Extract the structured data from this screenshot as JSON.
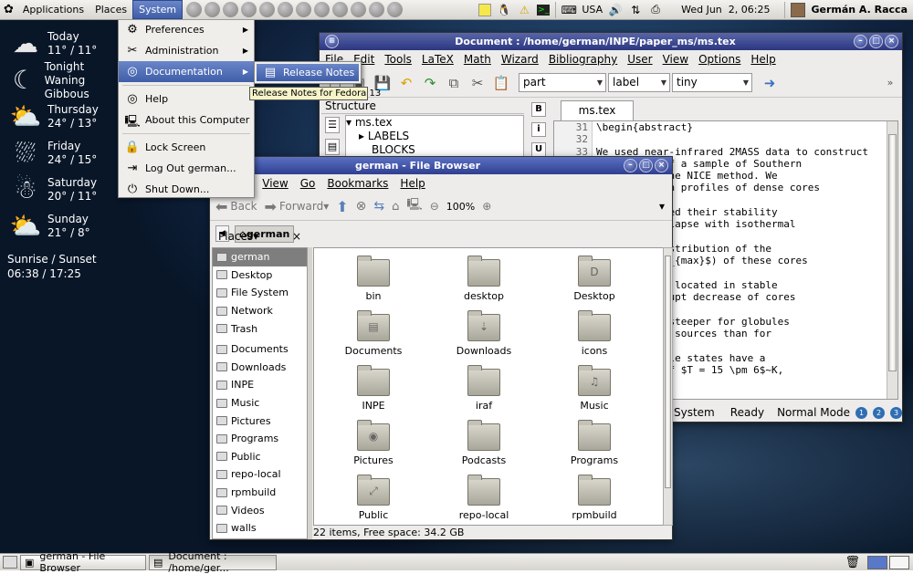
{
  "top_panel": {
    "menus": [
      "Applications",
      "Places",
      "System"
    ],
    "launchers": [
      "help-icon",
      "mail-icon",
      "chat-icon",
      "irc-icon",
      "im-icon",
      "network-icon",
      "music-icon",
      "star-icon",
      "web-icon",
      "doc-icon",
      "tools-icon",
      "terminal-icon"
    ],
    "keyboard_layout": "USA",
    "clock": "Wed Jun  2, 06:25",
    "user": "Germán A. Racca"
  },
  "weather": {
    "days": [
      {
        "name": "Today",
        "temps": "11° / 11°",
        "icon": "cloud-icon"
      },
      {
        "name": "Tonight",
        "temps": "Waning Gibbous",
        "icon": "moon-icon"
      },
      {
        "name": "Thursday",
        "temps": "24° / 13°",
        "icon": "sun-cloud-icon"
      },
      {
        "name": "Friday",
        "temps": "24° / 15°",
        "icon": "rain-icon"
      },
      {
        "name": "Saturday",
        "temps": "20° / 11°",
        "icon": "snow-cloud-icon"
      },
      {
        "name": "Sunday",
        "temps": "21° / 8°",
        "icon": "sun-cloud-icon"
      }
    ],
    "sun_label": "Sunrise / Sunset",
    "sun_times": "06:38 / 17:25"
  },
  "system_menu": {
    "items": [
      {
        "label": "Preferences",
        "submenu": true,
        "icon": "preferences-icon"
      },
      {
        "label": "Administration",
        "submenu": true,
        "icon": "administration-icon"
      },
      {
        "label": "Documentation",
        "submenu": true,
        "icon": "lifebuoy-icon"
      },
      {
        "label": "Help",
        "submenu": false,
        "icon": "help-icon"
      },
      {
        "label": "About this Computer",
        "submenu": false,
        "icon": "computer-icon"
      },
      {
        "label": "Lock Screen",
        "submenu": false,
        "icon": "lock-icon"
      },
      {
        "label": "Log Out german...",
        "submenu": false,
        "icon": "logout-icon"
      },
      {
        "label": "Shut Down...",
        "submenu": false,
        "icon": "shutdown-icon"
      }
    ],
    "submenu_item": "Release Notes",
    "tooltip": "Release Notes for Fedora 13"
  },
  "kile": {
    "title": "Document : /home/german/INPE/paper_ms/ms.tex",
    "menu": [
      "File",
      "Edit",
      "Tools",
      "LaTeX",
      "Math",
      "Wizard",
      "Bibliography",
      "User",
      "View",
      "Options",
      "Help"
    ],
    "combos": [
      "part",
      "label",
      "tiny"
    ],
    "structure_title": "Structure",
    "tree": [
      "ms.tex",
      "LABELS",
      "BLOCKS"
    ],
    "tab": "ms.tex",
    "line_numbers": [
      "31",
      "32",
      "33"
    ],
    "code_lines": [
      "\\begin{abstract}",
      "",
      "We used near-infrared 2MASS data to construct",
      "  ion maps of a sample of Southern",
      "  tilizing the NICE method. We",
      "   extinction profiles of dense cores",
      "",
      "s and analyzed their stability",
      "rational collapse with isothermal",
      "",
      "frequency distribution of the",
      "ameter ($\\xi_{max}$) of these cores",
      "",
      " of them are located in stable",
      "ed by an abrupt decrease of cores",
      "",
      "decrease is steeper for globules",
      "d IRAS point sources than for",
      "les.",
      "ules in stable states have a",
      "emperature of $T = 15 \\pm 6$~K,"
    ],
    "status": {
      "section": "System",
      "state": "Ready",
      "mode": "Normal Mode",
      "dots": [
        "1",
        "2",
        "3"
      ]
    }
  },
  "file_browser": {
    "title": "german - File Browser",
    "menu": [
      "Edit",
      "View",
      "Go",
      "Bookmarks",
      "Help"
    ],
    "back": "Back",
    "forward": "Forward",
    "zoom": "100%",
    "location": "german",
    "places_label": "Places",
    "places": [
      "german",
      "Desktop",
      "File System",
      "Network",
      "Trash",
      "Documents",
      "Downloads",
      "INPE",
      "Music",
      "Pictures",
      "Programs",
      "Public",
      "repo-local",
      "rpmbuild",
      "Videos",
      "walls"
    ],
    "folders": [
      {
        "name": "bin",
        "glyph": ""
      },
      {
        "name": "desktop",
        "glyph": ""
      },
      {
        "name": "Desktop",
        "glyph": "D"
      },
      {
        "name": "Documents",
        "glyph": "▤"
      },
      {
        "name": "Downloads",
        "glyph": "⇣"
      },
      {
        "name": "icons",
        "glyph": ""
      },
      {
        "name": "INPE",
        "glyph": ""
      },
      {
        "name": "iraf",
        "glyph": ""
      },
      {
        "name": "Music",
        "glyph": "♫"
      },
      {
        "name": "Pictures",
        "glyph": "◉"
      },
      {
        "name": "Podcasts",
        "glyph": ""
      },
      {
        "name": "Programs",
        "glyph": ""
      },
      {
        "name": "Public",
        "glyph": "⤢"
      },
      {
        "name": "repo-local",
        "glyph": ""
      },
      {
        "name": "rpmbuild",
        "glyph": ""
      }
    ],
    "status": "22 items, Free space: 34.2 GB"
  },
  "bottom_panel": {
    "tasks": [
      "german - File Browser",
      "Document : /home/ger..."
    ]
  }
}
